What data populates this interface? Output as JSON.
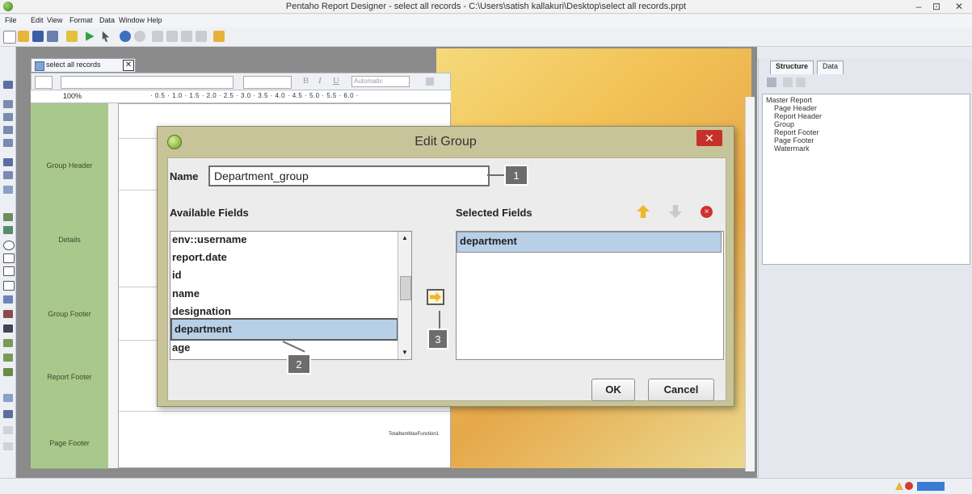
{
  "window": {
    "title": "Pentaho Report Designer - select all records - C:\\Users\\satish kallakuri\\Desktop\\select all records.prpt",
    "minimize": "–",
    "maximize": "⊡",
    "close": "✕"
  },
  "menu": [
    "File",
    "Edit",
    "View",
    "Format",
    "Data",
    "Window",
    "Help"
  ],
  "document_tab": {
    "label": "select all records",
    "close": "✕"
  },
  "format_bar": {
    "color_value": "Automatic"
  },
  "ruler": {
    "zoom": "100%",
    "marks": "· 0.5 · 1.0 · 1.5 · 2.0 · 2.5 · 3.0 · 3.5 · 4.0 · 4.5 · 5.0 · 5.5 · 6.0 ·"
  },
  "bands": [
    "Group Header",
    "Details",
    "Group Footer",
    "Report Footer",
    "Page Footer"
  ],
  "page_footer_field": "TotalItemMaxFunction1",
  "right_panel": {
    "tabs": [
      "Structure",
      "Data"
    ],
    "tree": [
      "Master Report",
      "Page Header",
      "Report Header",
      "Group",
      "Report Footer",
      "Page Footer",
      "Watermark"
    ]
  },
  "dialog": {
    "title": "Edit Group",
    "close": "✕",
    "name_label": "Name",
    "name_value": "Department_group",
    "available_label": "Available Fields",
    "selected_label": "Selected Fields",
    "available_fields": [
      "env::username",
      "report.date",
      "id",
      "name",
      "designation",
      "department",
      "age"
    ],
    "selected_item": "department",
    "selected_fields": [
      "department"
    ],
    "ok": "OK",
    "cancel": "Cancel",
    "callouts": [
      "1",
      "2",
      "3"
    ]
  },
  "colors": {
    "dialog_frame": "#c8c49a",
    "selection": "#b8cfe8",
    "callout": "#6d6d6d",
    "close_red": "#c7302a"
  }
}
